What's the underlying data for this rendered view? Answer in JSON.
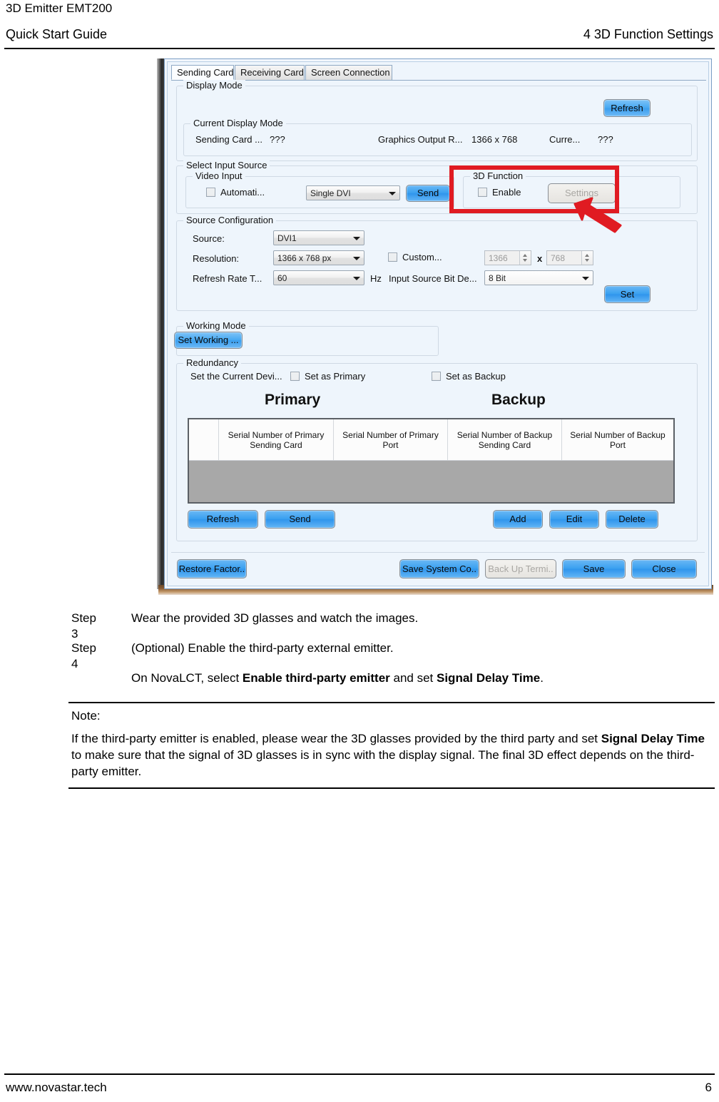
{
  "document": {
    "product": "3D Emitter EMT200",
    "guide": "Quick Start Guide",
    "chapter": "4 3D Function Settings",
    "footer_url": "www.novastar.tech",
    "page_number": "6"
  },
  "dialog": {
    "tabs": [
      {
        "label": "Sending Card",
        "active": true
      },
      {
        "label": "Receiving Card",
        "active": false
      },
      {
        "label": "Screen Connection",
        "active": false
      }
    ],
    "display_mode": {
      "title": "Display Mode",
      "refresh_label": "Refresh",
      "current": {
        "title": "Current Display Mode",
        "sending_card_label": "Sending Card ...",
        "sending_card_value": "???",
        "graphics_output_label": "Graphics Output R...",
        "graphics_output_value": "1366 x 768",
        "current_label": "Curre...",
        "current_value": "???"
      }
    },
    "select_input_source": {
      "title": "Select Input Source",
      "video_input": {
        "title": "Video Input",
        "auto_label": "Automati...",
        "auto_checked": false,
        "source_value": "Single DVI",
        "send_label": "Send"
      },
      "three_d_function": {
        "title": "3D Function",
        "enable_label": "Enable",
        "enable_checked": false,
        "settings_label": "Settings",
        "settings_disabled": true
      }
    },
    "source_configuration": {
      "title": "Source Configuration",
      "source_label": "Source:",
      "source_value": "DVI1",
      "resolution_label": "Resolution:",
      "resolution_value": "1366 x 768 px",
      "custom_label": "Custom...",
      "custom_checked": false,
      "custom_width": "1366",
      "custom_sep": "x",
      "custom_height": "768",
      "refresh_rate_label": "Refresh Rate T...",
      "refresh_rate_value": "60",
      "hz_label": "Hz",
      "bit_depth_label": "Input Source Bit De...",
      "bit_depth_value": "8 Bit",
      "set_label": "Set"
    },
    "working_mode": {
      "title": "Working Mode",
      "set_working_label": "Set Working ..."
    },
    "redundancy": {
      "title": "Redundancy",
      "set_current_label": "Set the Current Devi...",
      "primary_checkbox_label": "Set as Primary",
      "primary_checked": false,
      "backup_checkbox_label": "Set as Backup",
      "backup_checked": false,
      "primary_heading": "Primary",
      "backup_heading": "Backup",
      "table": {
        "columns": [
          "",
          "Serial Number of Primary Sending Card",
          "Serial Number of Primary Port",
          "Serial Number of Backup Sending Card",
          "Serial Number of Backup Port"
        ],
        "rows": []
      },
      "buttons": {
        "refresh": "Refresh",
        "send": "Send",
        "add": "Add",
        "edit": "Edit",
        "delete": "Delete"
      }
    },
    "footer_buttons": {
      "restore": "Restore Factor..",
      "save_system": "Save System Co..",
      "backup": "Back Up Termi..",
      "backup_disabled": true,
      "save": "Save",
      "close": "Close"
    },
    "annotation": {
      "color": "#e01b22",
      "target": "3D Function group / Settings button"
    }
  },
  "steps": [
    {
      "key": "Step 3",
      "text": "Wear the provided 3D glasses and watch the images."
    },
    {
      "key": "Step 4",
      "text": "(Optional) Enable the third-party external emitter."
    }
  ],
  "step4_detail": {
    "prefix": "On NovaLCT, select ",
    "bold1": "Enable third-party emitter",
    "middle": " and set ",
    "bold2": "Signal Delay Time",
    "suffix": "."
  },
  "note": {
    "title": "Note:",
    "part1": "If the third-party emitter is enabled, please wear the 3D glasses provided by the third party and set ",
    "bold": "Signal Delay Time",
    "part2": " to make sure that the signal of 3D glasses is in sync with the display signal. The final 3D effect depends on the third-party emitter."
  }
}
